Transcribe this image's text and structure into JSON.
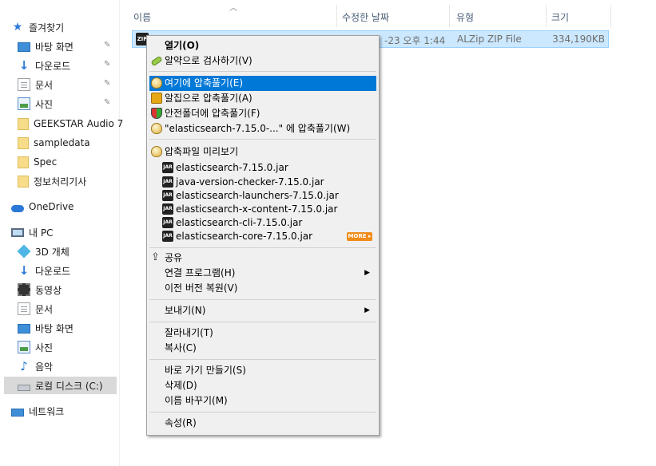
{
  "sidebar": {
    "quick_access": "즐겨찾기",
    "items": [
      {
        "label": "바탕 화면",
        "icon": "desktop-icon",
        "pinned": true
      },
      {
        "label": "다운로드",
        "icon": "download-icon",
        "pinned": true
      },
      {
        "label": "문서",
        "icon": "document-icon",
        "pinned": true
      },
      {
        "label": "사진",
        "icon": "pictures-icon",
        "pinned": true
      },
      {
        "label": "GEEKSTAR Audio 7",
        "icon": "folder-icon",
        "pinned": false
      },
      {
        "label": "sampledata",
        "icon": "folder-icon",
        "pinned": false
      },
      {
        "label": "Spec",
        "icon": "folder-icon",
        "pinned": false
      },
      {
        "label": "정보처리기사",
        "icon": "folder-icon",
        "pinned": false
      }
    ],
    "onedrive": "OneDrive",
    "this_pc": "내 PC",
    "pc_items": [
      {
        "label": "3D 개체",
        "icon": "3d-objects-icon"
      },
      {
        "label": "다운로드",
        "icon": "download-icon"
      },
      {
        "label": "동영상",
        "icon": "video-icon"
      },
      {
        "label": "문서",
        "icon": "document-icon"
      },
      {
        "label": "바탕 화면",
        "icon": "desktop-icon"
      },
      {
        "label": "사진",
        "icon": "pictures-icon"
      },
      {
        "label": "음악",
        "icon": "music-icon"
      },
      {
        "label": "로컬 디스크 (C:)",
        "icon": "drive-icon",
        "selected": true
      }
    ],
    "network": "네트워크"
  },
  "header": {
    "columns": [
      "이름",
      "수정한 날짜",
      "유형",
      "크기"
    ]
  },
  "file": {
    "date_partial": "-23 오후 1:44",
    "type": "ALZip ZIP File",
    "size": "334,190KB",
    "icon_text": "ZIP"
  },
  "menu": {
    "open": "열기(O)",
    "check_virus": "알약으로 검사하기(V)",
    "extract_here": "여기에 압축풀기(E)",
    "extract_alzip": "알집으로 압축풀기(A)",
    "extract_safe": "안전폴더에 압축풀기(F)",
    "extract_named": "\"elasticsearch-7.15.0-...\" 에 압축풀기(W)",
    "preview": "압축파일 미리보기",
    "jar_icon_text": "JAR",
    "jars": [
      "elasticsearch-7.15.0.jar",
      "java-version-checker-7.15.0.jar",
      "elasticsearch-launchers-7.15.0.jar",
      "elasticsearch-x-content-7.15.0.jar",
      "elasticsearch-cli-7.15.0.jar",
      "elasticsearch-core-7.15.0.jar"
    ],
    "more": "MORE ▸",
    "share": "공유",
    "open_with": "연결 프로그램(H)",
    "restore": "이전 버전 복원(V)",
    "send_to": "보내기(N)",
    "cut": "잘라내기(T)",
    "copy": "복사(C)",
    "shortcut": "바로 가기 만들기(S)",
    "delete": "삭제(D)",
    "rename": "이름 바꾸기(M)",
    "properties": "속성(R)"
  }
}
